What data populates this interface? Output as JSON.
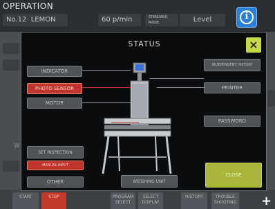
{
  "header": {
    "title": "OPERATION",
    "product_no": "No.12",
    "product_name": "LEMON",
    "speed": "60 p/min",
    "preset_label": "STANDARD MODE",
    "level_label": "Level"
  },
  "modal": {
    "title": "STATUS",
    "left_buttons": [
      "INDICATOR",
      "PHOTO SENSOR",
      "MOTOR"
    ],
    "right_buttons": [
      "INDEPENDENT HISTORY",
      "PRINTER",
      "PASSWORD"
    ],
    "lower_left_buttons": [
      "SET INSPECTION",
      "MANUAL INPUT",
      "OTHER"
    ],
    "weighing_unit": "WEIGHING UNIT",
    "close_label": "CLOSE"
  },
  "bottom_bar": {
    "buttons": [
      "START",
      "STOP",
      "PROGRAM SELECT",
      "SELECT DISPLAY",
      "HISTORY",
      "TROUBLE SHOOTING"
    ]
  },
  "colors": {
    "alarm_red": "#c0352c",
    "accent_green": "#a9b63b",
    "info_blue": "#2a7fd6"
  }
}
